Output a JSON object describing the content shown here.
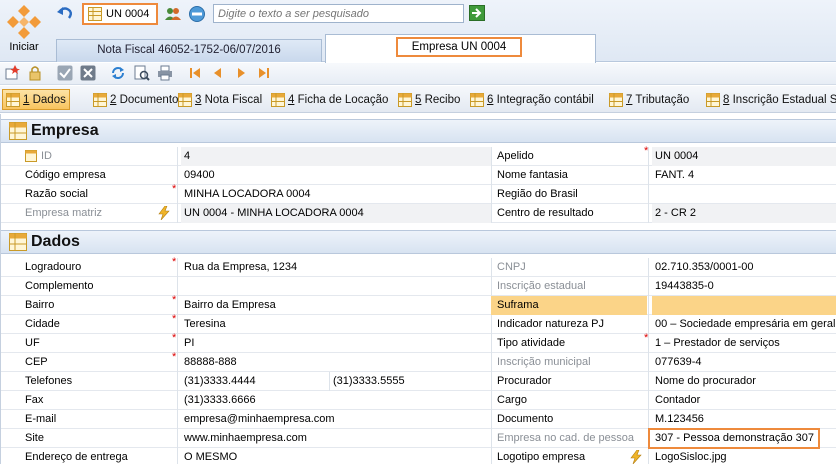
{
  "topbar": {
    "start_label": "Iniciar",
    "unit_button": "UN 0004",
    "search_placeholder": "Digite o texto a ser pesquisado"
  },
  "tabs": [
    {
      "label": "Nota Fiscal 46052-1752-06/07/2016"
    },
    {
      "label": "Empresa UN 0004"
    }
  ],
  "section_tabs": [
    {
      "num": "1",
      "label": "Dados"
    },
    {
      "num": "2",
      "label": "Documentos"
    },
    {
      "num": "3",
      "label": "Nota Fiscal"
    },
    {
      "num": "4",
      "label": "Ficha de Locação"
    },
    {
      "num": "5",
      "label": "Recibo"
    },
    {
      "num": "6",
      "label": "Integração contábil"
    },
    {
      "num": "7",
      "label": "Tributação"
    },
    {
      "num": "8",
      "label": "Inscrição Estadual ST"
    }
  ],
  "empresa": {
    "title": "Empresa",
    "rows": [
      {
        "l_label": "ID",
        "l_value": "4",
        "r_label": "Apelido",
        "r_value": "UN 0004"
      },
      {
        "l_label": "Código empresa",
        "l_value": "09400",
        "r_label": "Nome fantasia",
        "r_value": "FANT. 4"
      },
      {
        "l_label": "Razão social",
        "l_value": "MINHA LOCADORA 0004",
        "r_label": "Região do Brasil",
        "r_value": ""
      },
      {
        "l_label": "Empresa matriz",
        "l_value": "UN 0004 - MINHA LOCADORA 0004",
        "r_label": "Centro de resultado",
        "r_value": "2 - CR 2"
      }
    ]
  },
  "dados": {
    "title": "Dados",
    "rows": [
      {
        "l_label": "Logradouro",
        "l_value": "Rua da Empresa, 1234",
        "r_label": "CNPJ",
        "r_value": "02.710.353/0001-00"
      },
      {
        "l_label": "Complemento",
        "l_value": "",
        "r_label": "Inscrição estadual",
        "r_value": "19443835-0"
      },
      {
        "l_label": "Bairro",
        "l_value": "Bairro da Empresa",
        "r_label": "Suframa",
        "r_value": ""
      },
      {
        "l_label": "Cidade",
        "l_value": "Teresina",
        "r_label": "Indicador natureza PJ",
        "r_value": "00 – Sociedade empresária em geral"
      },
      {
        "l_label": "UF",
        "l_value": "PI",
        "r_label": "Tipo atividade",
        "r_value": "1 – Prestador de serviços"
      },
      {
        "l_label": "CEP",
        "l_value": "88888-888",
        "r_label": "Inscrição municipal",
        "r_value": "077639-4"
      },
      {
        "l_label": "Telefones",
        "l_value": "(31)3333.4444",
        "l_value2": "(31)3333.5555",
        "r_label": "Procurador",
        "r_value": "Nome do procurador"
      },
      {
        "l_label": "Fax",
        "l_value": "(31)3333.6666",
        "r_label": "Cargo",
        "r_value": "Contador"
      },
      {
        "l_label": "E-mail",
        "l_value": "empresa@minhaempresa.com",
        "r_label": "Documento",
        "r_value": "M.123456"
      },
      {
        "l_label": "Site",
        "l_value": "www.minhaempresa.com",
        "r_label": "Empresa no cad. de pessoa",
        "r_value": "307 - Pessoa demonstração 307"
      },
      {
        "l_label": "Endereço de entrega",
        "l_value": "O MESMO",
        "r_label": "Logotipo empresa",
        "r_value": "LogoSisloc.jpg"
      }
    ]
  },
  "colors": {
    "accent": "#ee8a3c",
    "required": "#dd0000",
    "active_tab": "#f8c45e"
  }
}
